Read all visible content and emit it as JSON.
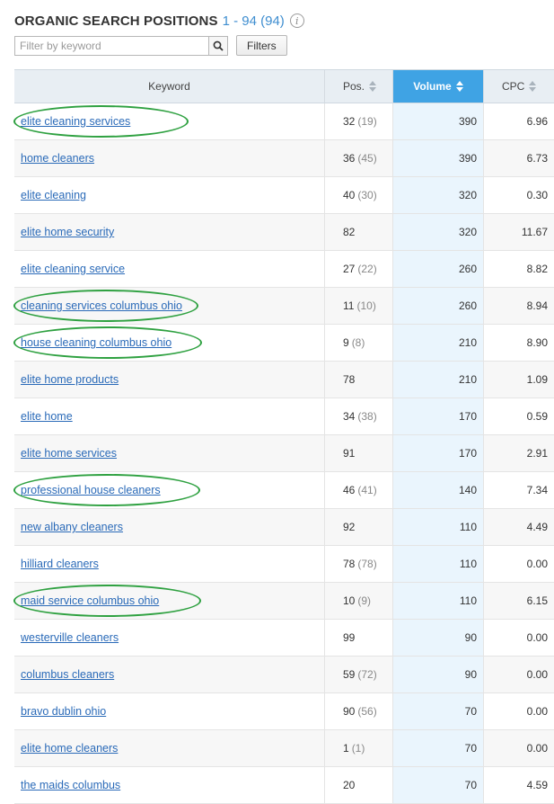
{
  "header": {
    "title": "ORGANIC SEARCH POSITIONS",
    "range": "1 - 94 (94)",
    "info_icon": "info-icon"
  },
  "filter": {
    "placeholder": "Filter by keyword",
    "search_icon": "search-icon",
    "filters_label": "Filters"
  },
  "table": {
    "columns": [
      {
        "label": "Keyword"
      },
      {
        "label": "Pos."
      },
      {
        "label": "Volume",
        "active": true
      },
      {
        "label": "CPC"
      }
    ],
    "rows": [
      {
        "keyword": "elite cleaning services",
        "pos": "32",
        "prev": "(19)",
        "volume": "390",
        "cpc": "6.96",
        "highlighted": true
      },
      {
        "keyword": "home cleaners",
        "pos": "36",
        "prev": "(45)",
        "volume": "390",
        "cpc": "6.73",
        "highlighted": false
      },
      {
        "keyword": "elite cleaning",
        "pos": "40",
        "prev": "(30)",
        "volume": "320",
        "cpc": "0.30",
        "highlighted": false
      },
      {
        "keyword": "elite home security",
        "pos": "82",
        "prev": "",
        "volume": "320",
        "cpc": "11.67",
        "highlighted": false
      },
      {
        "keyword": "elite cleaning service",
        "pos": "27",
        "prev": "(22)",
        "volume": "260",
        "cpc": "8.82",
        "highlighted": false
      },
      {
        "keyword": "cleaning services columbus ohio",
        "pos": "11",
        "prev": "(10)",
        "volume": "260",
        "cpc": "8.94",
        "highlighted": true
      },
      {
        "keyword": "house cleaning columbus ohio",
        "pos": "9",
        "prev": "(8)",
        "volume": "210",
        "cpc": "8.90",
        "highlighted": true
      },
      {
        "keyword": "elite home products",
        "pos": "78",
        "prev": "",
        "volume": "210",
        "cpc": "1.09",
        "highlighted": false
      },
      {
        "keyword": "elite home",
        "pos": "34",
        "prev": "(38)",
        "volume": "170",
        "cpc": "0.59",
        "highlighted": false
      },
      {
        "keyword": "elite home services",
        "pos": "91",
        "prev": "",
        "volume": "170",
        "cpc": "2.91",
        "highlighted": false
      },
      {
        "keyword": "professional house cleaners",
        "pos": "46",
        "prev": "(41)",
        "volume": "140",
        "cpc": "7.34",
        "highlighted": true
      },
      {
        "keyword": "new albany cleaners",
        "pos": "92",
        "prev": "",
        "volume": "110",
        "cpc": "4.49",
        "highlighted": false
      },
      {
        "keyword": "hilliard cleaners",
        "pos": "78",
        "prev": "(78)",
        "volume": "110",
        "cpc": "0.00",
        "highlighted": false
      },
      {
        "keyword": "maid service columbus ohio",
        "pos": "10",
        "prev": "(9)",
        "volume": "110",
        "cpc": "6.15",
        "highlighted": true
      },
      {
        "keyword": "westerville cleaners",
        "pos": "99",
        "prev": "",
        "volume": "90",
        "cpc": "0.00",
        "highlighted": false
      },
      {
        "keyword": "columbus cleaners",
        "pos": "59",
        "prev": "(72)",
        "volume": "90",
        "cpc": "0.00",
        "highlighted": false
      },
      {
        "keyword": "bravo dublin ohio",
        "pos": "90",
        "prev": "(56)",
        "volume": "70",
        "cpc": "0.00",
        "highlighted": false
      },
      {
        "keyword": "elite home cleaners",
        "pos": "1",
        "prev": "(1)",
        "volume": "70",
        "cpc": "0.00",
        "highlighted": false
      },
      {
        "keyword": "the maids columbus",
        "pos": "20",
        "prev": "",
        "volume": "70",
        "cpc": "4.59",
        "highlighted": false
      }
    ]
  },
  "colors": {
    "accent": "#3fa3e4",
    "link": "#2a6ab8",
    "highlight_circle": "#2fa141"
  }
}
